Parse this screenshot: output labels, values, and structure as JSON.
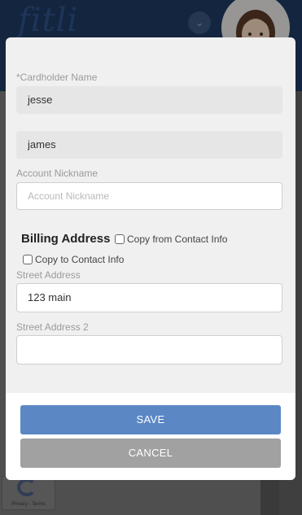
{
  "background": {
    "logo_text": "fitli",
    "recaptcha_text": "Privacy - Terms"
  },
  "form": {
    "cardholder_label": "*Cardholder Name",
    "first_name_value": "jesse",
    "last_name_value": "james",
    "nickname_label": "Account Nickname",
    "nickname_placeholder": "Account Nickname",
    "billing_title": "Billing Address",
    "copy_from_contact_label": "Copy from Contact Info",
    "copy_to_contact_label": "Copy to Contact Info",
    "street_label": "Street Address",
    "street_value": "123 main",
    "street2_label": "Street Address 2",
    "street2_value": ""
  },
  "buttons": {
    "save_label": "SAVE",
    "cancel_label": "CANCEL"
  },
  "colors": {
    "header_bg": "#1f3a63",
    "save_button": "#5b87c5",
    "cancel_button": "#a1a1a1",
    "modal_bg": "#f0f0f0"
  },
  "icons": {
    "header_chevron": "chevron-down-icon",
    "avatar": "user-avatar",
    "recaptcha": "recaptcha-icon"
  }
}
